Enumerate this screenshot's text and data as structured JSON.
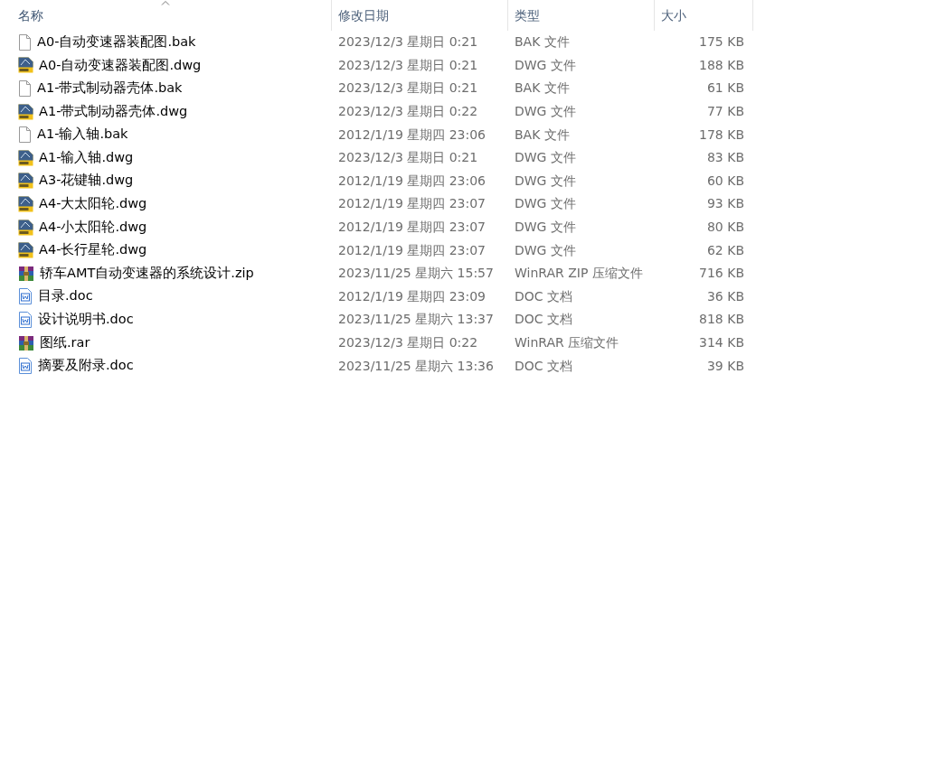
{
  "columns": [
    {
      "label": "名称",
      "sorted": true
    },
    {
      "label": "修改日期",
      "sorted": false
    },
    {
      "label": "类型",
      "sorted": false
    },
    {
      "label": "大小",
      "sorted": false
    }
  ],
  "files": [
    {
      "kind": "file",
      "name": "A0-自动变速器装配图.bak",
      "date": "2023/12/3 星期日 0:21",
      "type": "BAK 文件",
      "size": "175 KB"
    },
    {
      "kind": "dwg",
      "name": "A0-自动变速器装配图.dwg",
      "date": "2023/12/3 星期日 0:21",
      "type": "DWG 文件",
      "size": "188 KB"
    },
    {
      "kind": "file",
      "name": "A1-带式制动器壳体.bak",
      "date": "2023/12/3 星期日 0:21",
      "type": "BAK 文件",
      "size": "61 KB"
    },
    {
      "kind": "dwg",
      "name": "A1-带式制动器壳体.dwg",
      "date": "2023/12/3 星期日 0:22",
      "type": "DWG 文件",
      "size": "77 KB"
    },
    {
      "kind": "file",
      "name": "A1-输入轴.bak",
      "date": "2012/1/19 星期四 23:06",
      "type": "BAK 文件",
      "size": "178 KB"
    },
    {
      "kind": "dwg",
      "name": "A1-输入轴.dwg",
      "date": "2023/12/3 星期日 0:21",
      "type": "DWG 文件",
      "size": "83 KB"
    },
    {
      "kind": "dwg",
      "name": "A3-花键轴.dwg",
      "date": "2012/1/19 星期四 23:06",
      "type": "DWG 文件",
      "size": "60 KB"
    },
    {
      "kind": "dwg",
      "name": "A4-大太阳轮.dwg",
      "date": "2012/1/19 星期四 23:07",
      "type": "DWG 文件",
      "size": "93 KB"
    },
    {
      "kind": "dwg",
      "name": "A4-小太阳轮.dwg",
      "date": "2012/1/19 星期四 23:07",
      "type": "DWG 文件",
      "size": "80 KB"
    },
    {
      "kind": "dwg",
      "name": "A4-长行星轮.dwg",
      "date": "2012/1/19 星期四 23:07",
      "type": "DWG 文件",
      "size": "62 KB"
    },
    {
      "kind": "archive",
      "name": "轿车AMT自动变速器的系统设计.zip",
      "date": "2023/11/25 星期六 15:57",
      "type": "WinRAR ZIP 压缩文件",
      "size": "716 KB"
    },
    {
      "kind": "doc",
      "name": "目录.doc",
      "date": "2012/1/19 星期四 23:09",
      "type": "DOC 文档",
      "size": "36 KB"
    },
    {
      "kind": "doc",
      "name": "设计说明书.doc",
      "date": "2023/11/25 星期六 13:37",
      "type": "DOC 文档",
      "size": "818 KB"
    },
    {
      "kind": "archive",
      "name": "图纸.rar",
      "date": "2023/12/3 星期日 0:22",
      "type": "WinRAR 压缩文件",
      "size": "314 KB"
    },
    {
      "kind": "doc",
      "name": "摘要及附录.doc",
      "date": "2023/11/25 星期六 13:36",
      "type": "DOC 文档",
      "size": "39 KB"
    }
  ]
}
